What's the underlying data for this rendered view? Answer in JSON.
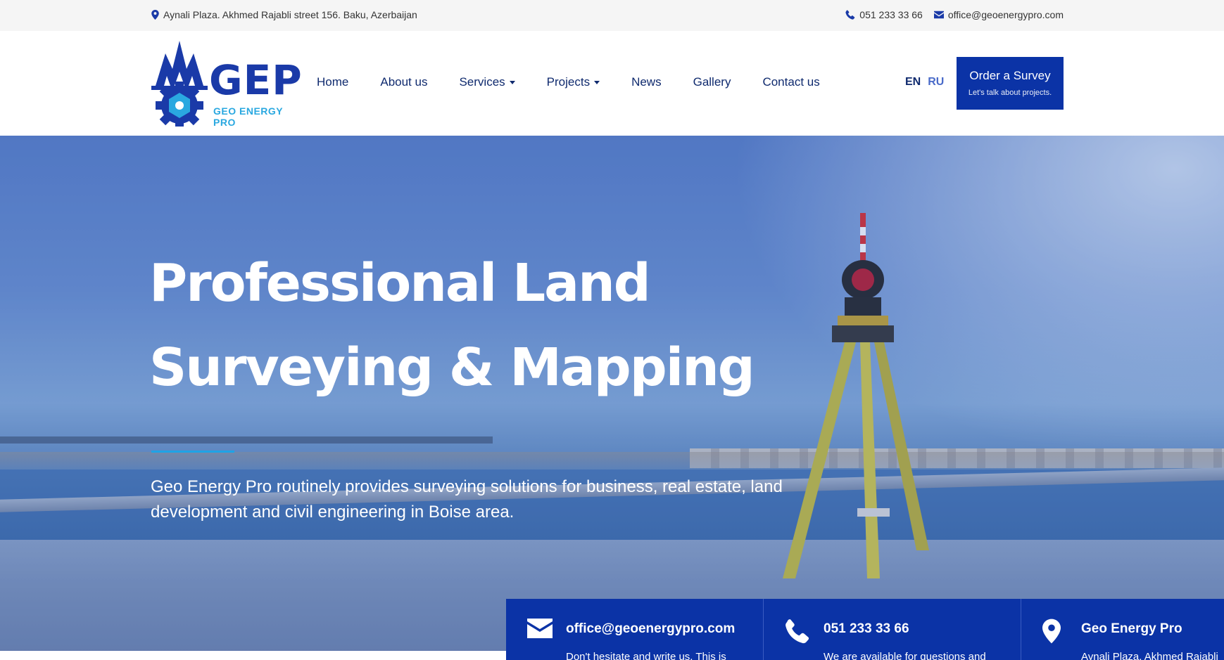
{
  "topbar": {
    "address": "Aynali Plaza. Akhmed Rajabli street 156. Baku, Azerbaijan",
    "phone": "051 233 33 66",
    "email": "office@geoenergypro.com",
    "icons": [
      "map-pin-icon",
      "phone-icon",
      "envelope-icon"
    ]
  },
  "logo": {
    "word": "GEP",
    "subtitle": "GEO ENERGY PRO"
  },
  "nav": {
    "items": [
      {
        "label": "Home",
        "dropdown": false
      },
      {
        "label": "About us",
        "dropdown": false
      },
      {
        "label": "Services",
        "dropdown": true
      },
      {
        "label": "Projects",
        "dropdown": true
      },
      {
        "label": "News",
        "dropdown": false
      },
      {
        "label": "Gallery",
        "dropdown": false
      },
      {
        "label": "Contact us",
        "dropdown": false
      }
    ]
  },
  "lang": {
    "en": "EN",
    "ru": "RU",
    "active": "EN"
  },
  "order_button": {
    "title": "Order a Survey",
    "subtitle": "Let's talk about projects."
  },
  "hero": {
    "title_line1": "Professional Land",
    "title_line2": "Surveying & Mapping",
    "lead": "Geo Energy Pro routinely provides surveying solutions for business, real estate, land development and civil engineering in Boise area."
  },
  "cards": [
    {
      "icon": "envelope-icon",
      "title": "office@geoenergypro.com",
      "text": "Don't hesitate and write us. This is"
    },
    {
      "icon": "phone-icon",
      "title": "051 233 33 66",
      "text": "We are available for questions and"
    },
    {
      "icon": "map-pin-icon",
      "title": "Geo Energy Pro",
      "text": "Aynali Plaza. Akhmed Rajabli"
    }
  ],
  "colors": {
    "brand": "#0b33a6",
    "accent": "#1fa3e6",
    "nav_text": "#0f2a6e",
    "topbar_bg": "#f5f5f5"
  }
}
